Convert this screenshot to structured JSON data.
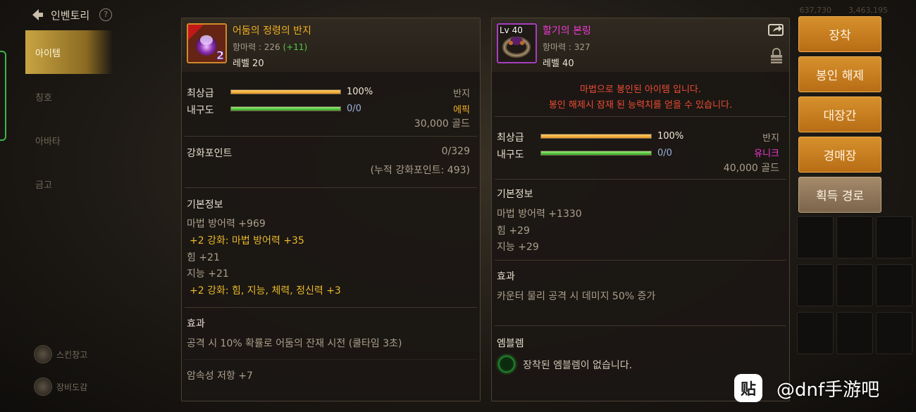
{
  "nav": {
    "title": "인벤토리",
    "help": "?",
    "tabs": [
      "아이템",
      "칭호",
      "아바타",
      "금고"
    ],
    "bottom": [
      "스킨창고",
      "장비도감"
    ]
  },
  "status": {
    "values": [
      "637,730",
      "3,463,195"
    ]
  },
  "left_item": {
    "badge": "2",
    "name": "어둠의 정령의 반지",
    "stat_label": "항마력 : 226",
    "stat_bonus": "(+11)",
    "level": "레벨 20",
    "grade_label": "최상급",
    "grade_pct": "100%",
    "grade_fill": 1.0,
    "durability_label": "내구도",
    "durability_value": "0/0",
    "durability_fill": 1.0,
    "type": "반지",
    "rarity": "에픽",
    "price": "30,000 골드",
    "enhance_label": "강화포인트",
    "enhance_value": "0/329",
    "enhance_total": "(누적 강화포인트: 493)",
    "basic_title": "기본정보",
    "basic_lines": [
      {
        "text": "마법 방어력 +969",
        "style": "normal"
      },
      {
        "text": "+2 강화: 마법 방어력 +35",
        "style": "gold"
      },
      {
        "text": "힘 +21",
        "style": "normal"
      },
      {
        "text": "지능 +21",
        "style": "normal"
      },
      {
        "text": "+2 강화: 힘, 지능, 체력, 정신력 +3",
        "style": "gold"
      }
    ],
    "effect_title": "효과",
    "effect_text": "공격 시 10% 확률로 어둠의 잔재 시전 (쿨타임 3초)",
    "resist_text": "암속성 저항 +7"
  },
  "right_item": {
    "level_badge": "Lv 40",
    "name": "할기의 본링",
    "stat_label": "항마력 : 327",
    "level": "레벨 40",
    "sealed_line1": "마법으로 봉인된 아이템 입니다.",
    "sealed_line2": "봉인 해제시 잠재 된 능력치를 얻을 수 있습니다.",
    "grade_label": "최상급",
    "grade_pct": "100%",
    "grade_fill": 1.0,
    "durability_label": "내구도",
    "durability_value": "0/0",
    "durability_fill": 1.0,
    "type": "반지",
    "rarity": "유니크",
    "price": "40,000 골드",
    "basic_title": "기본정보",
    "basic_lines": [
      "마법 방어력 +1330",
      "힘 +29",
      "지능 +29"
    ],
    "effect_title": "효과",
    "effect_text": "카운터 물리 공격 시 데미지 50% 증가",
    "emblem_title": "엠블렘",
    "emblem_text": "장착된 엠블렘이 없습니다."
  },
  "buttons": {
    "equip": "장착",
    "unseal": "봉인 해제",
    "smith": "대장간",
    "auction": "경매장",
    "source": "획득 경로"
  },
  "watermark": {
    "icon": "贴",
    "text": "@dnf手游吧"
  },
  "colors": {
    "gold_text": "#e9b92a",
    "epic": "#f2b020",
    "unique": "#f23bd6",
    "sealed_red": "#ee4c34",
    "button_gold": "#c77d1f",
    "button_tan": "#8f7658"
  },
  "icons": [
    "back-arrow-icon",
    "help-icon",
    "share-icon",
    "lock-icon",
    "ring-epic-icon",
    "ring-unique-icon",
    "emblem-slot-icon"
  ]
}
